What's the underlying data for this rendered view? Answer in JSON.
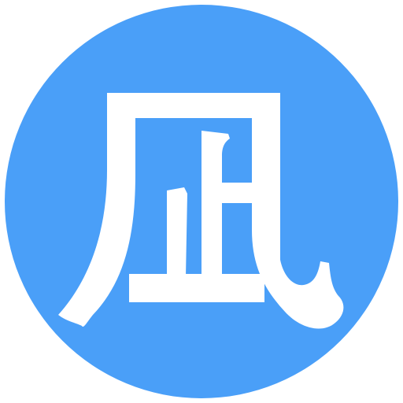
{
  "icon": {
    "name": "character-icon",
    "glyph": "凪",
    "background_color": "#4a9ff8",
    "glyph_color": "#ffffff"
  }
}
